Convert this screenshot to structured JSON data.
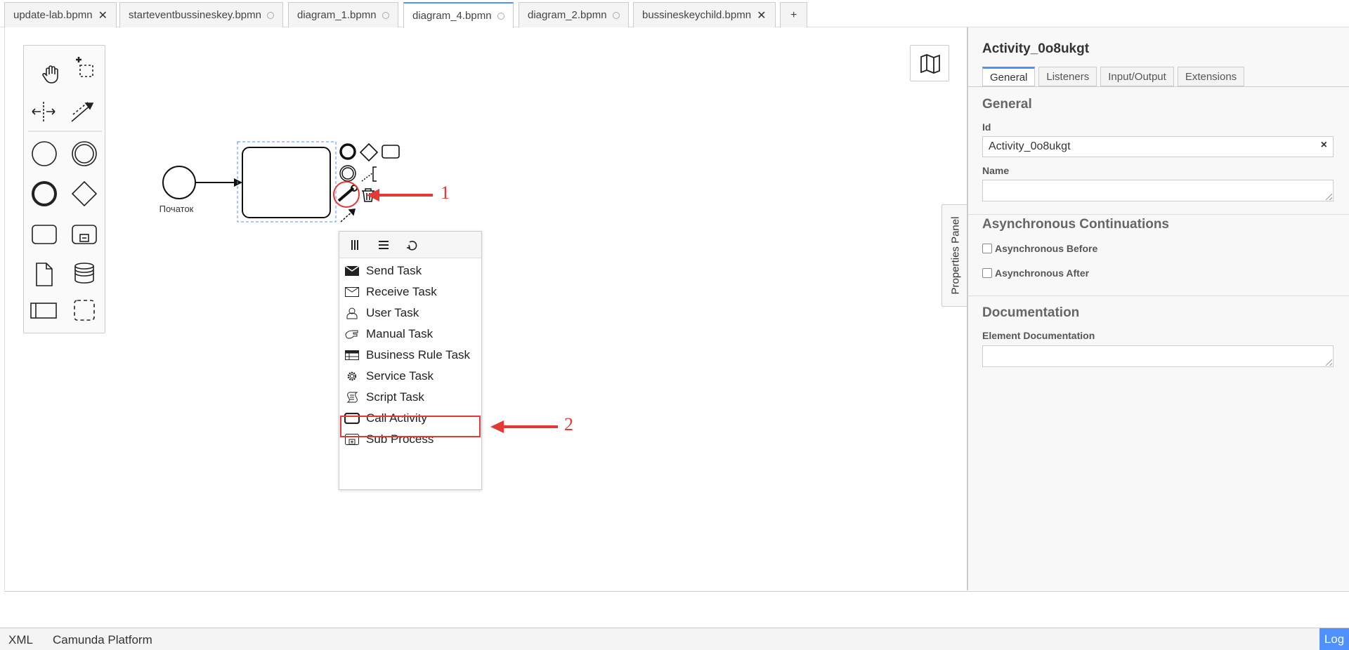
{
  "tabs": [
    {
      "label": "update-lab.bpmn",
      "state": "close"
    },
    {
      "label": "starteventbussineskey.bpmn",
      "state": "dot"
    },
    {
      "label": "diagram_1.bpmn",
      "state": "dot"
    },
    {
      "label": "diagram_4.bpmn",
      "state": "dot",
      "active": true
    },
    {
      "label": "diagram_2.bpmn",
      "state": "dot"
    },
    {
      "label": "bussineskeychild.bpmn",
      "state": "close"
    }
  ],
  "tab_add_label": "+",
  "tab_close_glyph": "✕",
  "diagram": {
    "start_event_label": "Початок"
  },
  "annotations": {
    "marker_1": "1",
    "marker_2": "2",
    "color": "#e53935"
  },
  "popup": {
    "entries": [
      {
        "label": "Send Task",
        "icon": "send-task-icon"
      },
      {
        "label": "Receive Task",
        "icon": "receive-task-icon"
      },
      {
        "label": "User Task",
        "icon": "user-task-icon"
      },
      {
        "label": "Manual Task",
        "icon": "manual-task-icon"
      },
      {
        "label": "Business Rule Task",
        "icon": "business-rule-task-icon"
      },
      {
        "label": "Service Task",
        "icon": "service-task-icon"
      },
      {
        "label": "Script Task",
        "icon": "script-task-icon",
        "highlighted": true
      },
      {
        "label": "Call Activity",
        "icon": "call-activity-icon"
      },
      {
        "label": "Sub Process",
        "icon": "sub-process-icon"
      }
    ]
  },
  "properties": {
    "title": "Activity_0o8ukgt",
    "tabs": [
      "General",
      "Listeners",
      "Input/Output",
      "Extensions"
    ],
    "active_tab": "General",
    "general_title": "General",
    "id_label": "Id",
    "id_value": "Activity_0o8ukgt",
    "clear_glyph": "×",
    "name_label": "Name",
    "name_value": "",
    "async_title": "Asynchronous Continuations",
    "async_before_label": "Asynchronous Before",
    "async_after_label": "Asynchronous After",
    "async_before_checked": false,
    "async_after_checked": false,
    "doc_title": "Documentation",
    "doc_label": "Element Documentation",
    "vertical_tab_label": "Properties Panel"
  },
  "status_bar": {
    "xml_label": "XML",
    "platform_label": "Camunda Platform",
    "log_label": "Log"
  },
  "colors": {
    "accent": "#4d90fe",
    "annotation_red": "#e53935"
  }
}
